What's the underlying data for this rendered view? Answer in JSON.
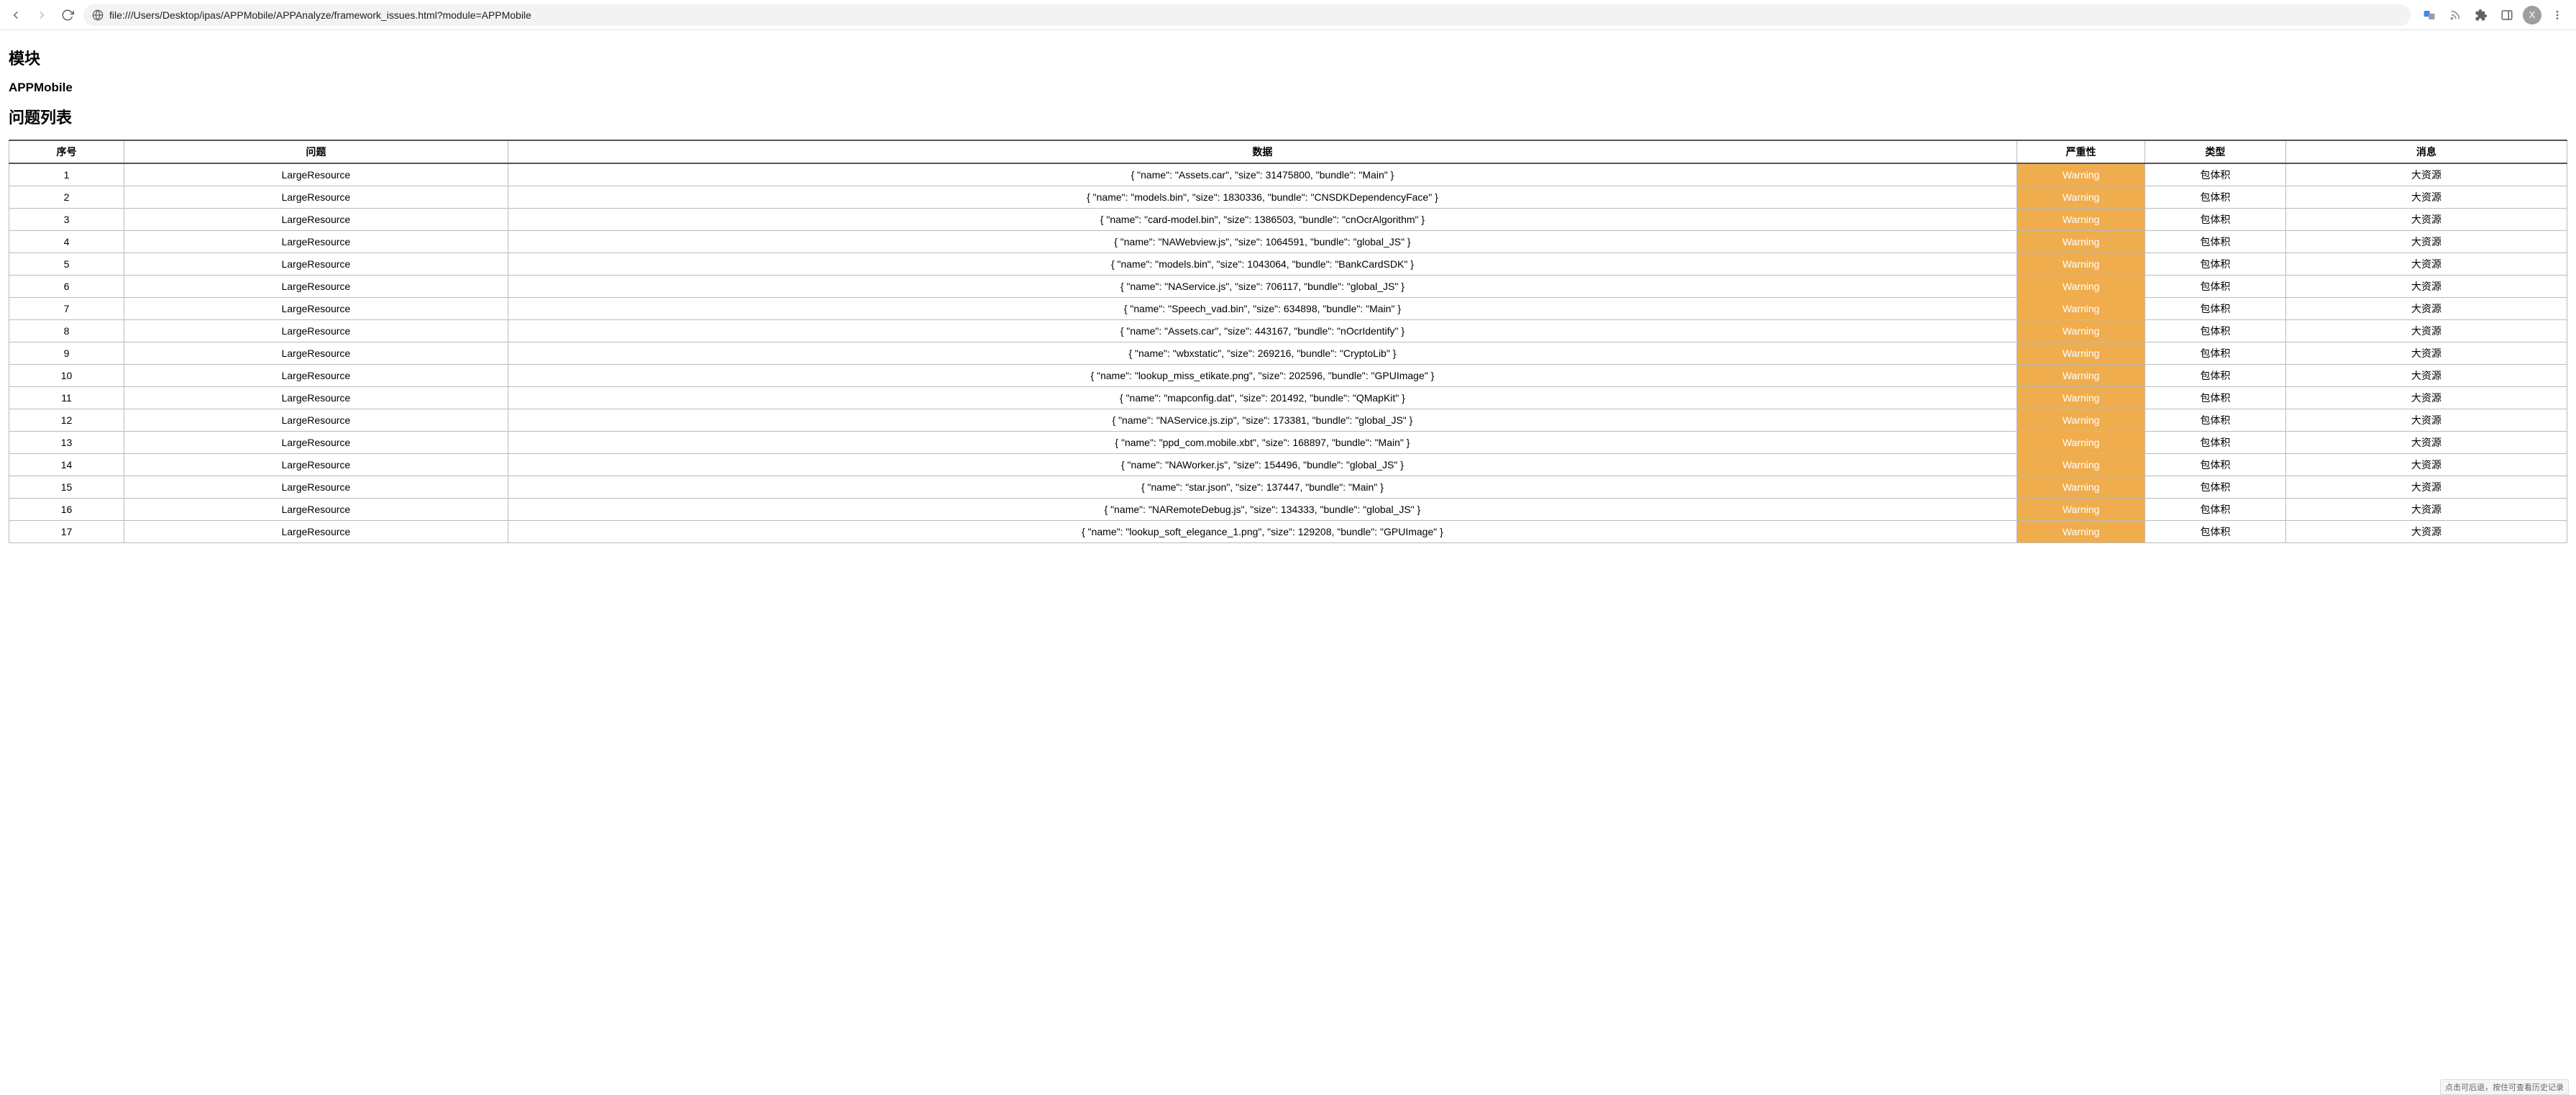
{
  "browser": {
    "url": "file:///Users/Desktop/ipas/APPMobile/APPAnalyze/framework_issues.html?module=APPMobile",
    "avatar_initial": "X"
  },
  "page": {
    "section_module": "模块",
    "module_name": "APPMobile",
    "section_issues": "问题列表"
  },
  "table": {
    "headers": {
      "index": "序号",
      "issue": "问题",
      "data": "数据",
      "severity": "严重性",
      "type": "类型",
      "message": "消息"
    },
    "rows": [
      {
        "index": "1",
        "issue": "LargeResource",
        "data": "{ \"name\": \"Assets.car\", \"size\": 31475800, \"bundle\": \"Main\" }",
        "severity": "Warning",
        "type": "包体积",
        "message": "大资源"
      },
      {
        "index": "2",
        "issue": "LargeResource",
        "data": "{ \"name\": \"models.bin\", \"size\": 1830336, \"bundle\": \"CNSDKDependencyFace\" }",
        "severity": "Warning",
        "type": "包体积",
        "message": "大资源"
      },
      {
        "index": "3",
        "issue": "LargeResource",
        "data": "{ \"name\": \"card-model.bin\", \"size\": 1386503, \"bundle\": \"cnOcrAlgorithm\" }",
        "severity": "Warning",
        "type": "包体积",
        "message": "大资源"
      },
      {
        "index": "4",
        "issue": "LargeResource",
        "data": "{ \"name\": \"NAWebview.js\", \"size\": 1064591, \"bundle\": \"global_JS\" }",
        "severity": "Warning",
        "type": "包体积",
        "message": "大资源"
      },
      {
        "index": "5",
        "issue": "LargeResource",
        "data": "{ \"name\": \"models.bin\", \"size\": 1043064, \"bundle\": \"BankCardSDK\" }",
        "severity": "Warning",
        "type": "包体积",
        "message": "大资源"
      },
      {
        "index": "6",
        "issue": "LargeResource",
        "data": "{ \"name\": \"NAService.js\", \"size\": 706117, \"bundle\": \"global_JS\" }",
        "severity": "Warning",
        "type": "包体积",
        "message": "大资源"
      },
      {
        "index": "7",
        "issue": "LargeResource",
        "data": "{ \"name\": \"Speech_vad.bin\", \"size\": 634898, \"bundle\": \"Main\" }",
        "severity": "Warning",
        "type": "包体积",
        "message": "大资源"
      },
      {
        "index": "8",
        "issue": "LargeResource",
        "data": "{ \"name\": \"Assets.car\", \"size\": 443167, \"bundle\": \"nOcrIdentify\" }",
        "severity": "Warning",
        "type": "包体积",
        "message": "大资源"
      },
      {
        "index": "9",
        "issue": "LargeResource",
        "data": "{ \"name\": \"wbxstatic\", \"size\": 269216, \"bundle\": \"CryptoLib\" }",
        "severity": "Warning",
        "type": "包体积",
        "message": "大资源"
      },
      {
        "index": "10",
        "issue": "LargeResource",
        "data": "{ \"name\": \"lookup_miss_etikate.png\", \"size\": 202596, \"bundle\": \"GPUImage\" }",
        "severity": "Warning",
        "type": "包体积",
        "message": "大资源"
      },
      {
        "index": "11",
        "issue": "LargeResource",
        "data": "{ \"name\": \"mapconfig.dat\", \"size\": 201492, \"bundle\": \"QMapKit\" }",
        "severity": "Warning",
        "type": "包体积",
        "message": "大资源"
      },
      {
        "index": "12",
        "issue": "LargeResource",
        "data": "{ \"name\": \"NAService.js.zip\", \"size\": 173381, \"bundle\": \"global_JS\" }",
        "severity": "Warning",
        "type": "包体积",
        "message": "大资源"
      },
      {
        "index": "13",
        "issue": "LargeResource",
        "data": "{ \"name\": \"ppd_com.mobile.xbt\", \"size\": 168897, \"bundle\": \"Main\" }",
        "severity": "Warning",
        "type": "包体积",
        "message": "大资源"
      },
      {
        "index": "14",
        "issue": "LargeResource",
        "data": "{ \"name\": \"NAWorker.js\", \"size\": 154496, \"bundle\": \"global_JS\" }",
        "severity": "Warning",
        "type": "包体积",
        "message": "大资源"
      },
      {
        "index": "15",
        "issue": "LargeResource",
        "data": "{ \"name\": \"star.json\", \"size\": 137447, \"bundle\": \"Main\" }",
        "severity": "Warning",
        "type": "包体积",
        "message": "大资源"
      },
      {
        "index": "16",
        "issue": "LargeResource",
        "data": "{ \"name\": \"NARemoteDebug.js\", \"size\": 134333, \"bundle\": \"global_JS\" }",
        "severity": "Warning",
        "type": "包体积",
        "message": "大资源"
      },
      {
        "index": "17",
        "issue": "LargeResource",
        "data": "{ \"name\": \"lookup_soft_elegance_1.png\", \"size\": 129208, \"bundle\": \"GPUImage\" }",
        "severity": "Warning",
        "type": "包体积",
        "message": "大资源"
      }
    ]
  },
  "tooltip": "点击可后退，按住可查看历史记录"
}
